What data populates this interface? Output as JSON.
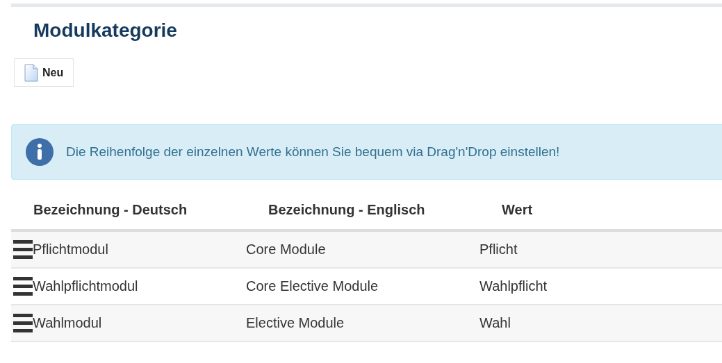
{
  "title": "Modulkategorie",
  "toolbar": {
    "new_button": "Neu"
  },
  "alert": {
    "text": "Die Reihenfolge der einzelnen Werte können Sie bequem via Drag'n'Drop einstellen!"
  },
  "table": {
    "columns": [
      "Bezeichnung - Deutsch",
      "Bezeichnung - Englisch",
      "Wert"
    ],
    "rows": [
      {
        "cells": [
          "Pflichtmodul",
          "Core Module",
          "Pflicht"
        ]
      },
      {
        "cells": [
          "Wahlpflichtmodul",
          "Core Elective Module",
          "Wahlpflicht"
        ]
      },
      {
        "cells": [
          "Wahlmodul",
          "Elective Module",
          "Wahl"
        ]
      }
    ]
  }
}
